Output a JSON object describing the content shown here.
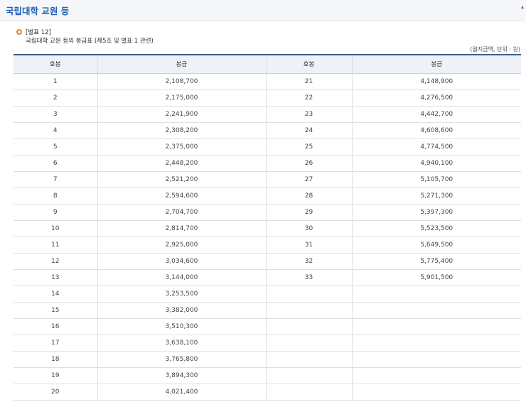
{
  "section": {
    "title": "국립대학 교원 등"
  },
  "caption": {
    "line1": "[별표 12]",
    "line2": "국립대학 교원 등의 봉급표 (제5조 및 별표 1 관련)"
  },
  "unit_note": "(월지급액, 단위 : 원)",
  "table": {
    "headers": [
      "호봉",
      "봉급",
      "호봉",
      "봉급"
    ],
    "rows": [
      [
        "1",
        "2,108,700",
        "21",
        "4,148,900"
      ],
      [
        "2",
        "2,175,000",
        "22",
        "4,276,500"
      ],
      [
        "3",
        "2,241,900",
        "23",
        "4,442,700"
      ],
      [
        "4",
        "2,308,200",
        "24",
        "4,608,600"
      ],
      [
        "5",
        "2,375,000",
        "25",
        "4,774,500"
      ],
      [
        "6",
        "2,448,200",
        "26",
        "4,940,100"
      ],
      [
        "7",
        "2,521,200",
        "27",
        "5,105,700"
      ],
      [
        "8",
        "2,594,600",
        "28",
        "5,271,300"
      ],
      [
        "9",
        "2,704,700",
        "29",
        "5,397,300"
      ],
      [
        "10",
        "2,814,700",
        "30",
        "5,523,500"
      ],
      [
        "11",
        "2,925,000",
        "31",
        "5,649,500"
      ],
      [
        "12",
        "3,034,600",
        "32",
        "5,775,400"
      ],
      [
        "13",
        "3,144,000",
        "33",
        "5,901,500"
      ],
      [
        "14",
        "3,253,500",
        "",
        ""
      ],
      [
        "15",
        "3,382,000",
        "",
        ""
      ],
      [
        "16",
        "3,510,300",
        "",
        ""
      ],
      [
        "17",
        "3,638,100",
        "",
        ""
      ],
      [
        "18",
        "3,765,800",
        "",
        ""
      ],
      [
        "19",
        "3,894,300",
        "",
        ""
      ],
      [
        "20",
        "4,021,400",
        "",
        ""
      ]
    ]
  }
}
